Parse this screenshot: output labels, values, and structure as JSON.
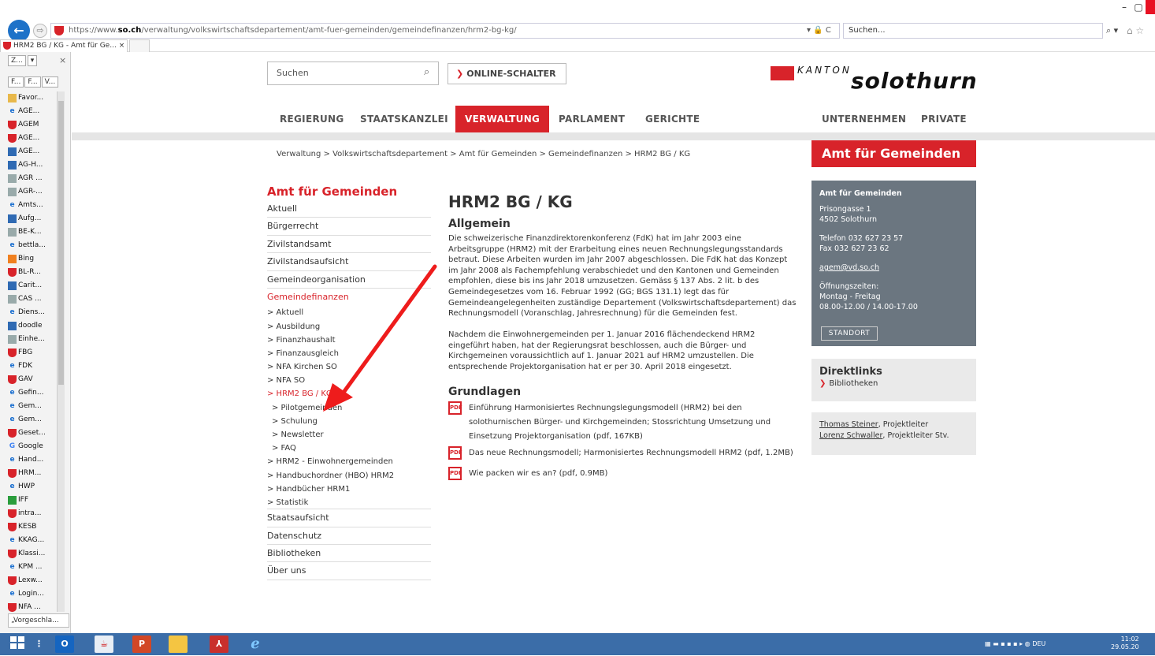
{
  "browser": {
    "url_prefix": "https://www.",
    "url_host": "so.ch",
    "url_path": "/verwaltung/volkswirtschaftsdepartement/amt-fuer-gemeinden/gemeindefinanzen/hrm2-bg-kg/",
    "url_icons": "▾ 🔒 C",
    "search_placeholder": "Suchen...",
    "search_icon": "⌕ ▾",
    "fav_icons": "⌂ ☆",
    "tab_title": "HRM2 BG / KG - Amt für Ge...",
    "tab_close": "×",
    "minimize": "–",
    "maximize": "▢"
  },
  "sidebar": {
    "dropdown_label": "Z...",
    "dropdown_arrow": "▾",
    "close": "×",
    "tabs": [
      "F...",
      "F...",
      "V..."
    ],
    "items": [
      {
        "label": "Favor...",
        "icon": "folder"
      },
      {
        "label": "AGE...",
        "icon": "ie"
      },
      {
        "label": "AGEM",
        "icon": "red"
      },
      {
        "label": "AGE...",
        "icon": "red"
      },
      {
        "label": "AGE...",
        "icon": "blue"
      },
      {
        "label": "AG-H...",
        "icon": "blue"
      },
      {
        "label": "AGR ...",
        "icon": "grey"
      },
      {
        "label": "AGR-...",
        "icon": "grey"
      },
      {
        "label": "Amts...",
        "icon": "ie"
      },
      {
        "label": "Aufg...",
        "icon": "blue"
      },
      {
        "label": "BE-K...",
        "icon": "grey"
      },
      {
        "label": "bettla...",
        "icon": "ie"
      },
      {
        "label": "Bing",
        "icon": "orange"
      },
      {
        "label": "BL-R...",
        "icon": "red"
      },
      {
        "label": "Carit...",
        "icon": "blue"
      },
      {
        "label": "CAS ...",
        "icon": "grey"
      },
      {
        "label": "Diens...",
        "icon": "ie"
      },
      {
        "label": "doodle",
        "icon": "blue"
      },
      {
        "label": "Einhe...",
        "icon": "grey"
      },
      {
        "label": "FBG",
        "icon": "red"
      },
      {
        "label": "FDK",
        "icon": "ie"
      },
      {
        "label": "GAV",
        "icon": "red"
      },
      {
        "label": "Gefin...",
        "icon": "ie"
      },
      {
        "label": "Gem...",
        "icon": "ie"
      },
      {
        "label": "Gem...",
        "icon": "ie"
      },
      {
        "label": "Geset...",
        "icon": "red"
      },
      {
        "label": "Google",
        "icon": "google"
      },
      {
        "label": "Hand...",
        "icon": "ie"
      },
      {
        "label": "HRM...",
        "icon": "red"
      },
      {
        "label": "HWP",
        "icon": "ie"
      },
      {
        "label": "IFF",
        "icon": "green"
      },
      {
        "label": "intra...",
        "icon": "red"
      },
      {
        "label": "KESB",
        "icon": "red"
      },
      {
        "label": "KKAG...",
        "icon": "ie"
      },
      {
        "label": "Klassi...",
        "icon": "red"
      },
      {
        "label": "KPM ...",
        "icon": "ie"
      },
      {
        "label": "Lexw...",
        "icon": "red"
      },
      {
        "label": "Login...",
        "icon": "ie"
      },
      {
        "label": "NFA ...",
        "icon": "red"
      }
    ],
    "bottom_label": "„Vorgeschla..."
  },
  "header": {
    "search_placeholder": "Suchen",
    "search_icon": "⌕",
    "online_chev": "❯",
    "online_label": "ONLINE-SCHALTER",
    "logo_kanton": "KANTON",
    "logo_name": "solothurn"
  },
  "mainnav": {
    "items": [
      {
        "label": "REGIERUNG",
        "active": false
      },
      {
        "label": "STAATSKANZLEI",
        "active": false
      },
      {
        "label": "VERWALTUNG",
        "active": true
      },
      {
        "label": "PARLAMENT",
        "active": false
      },
      {
        "label": "GERICHTE",
        "active": false
      },
      {
        "label": "UNTERNEHMEN",
        "active": false
      },
      {
        "label": "PRIVATE",
        "active": false
      }
    ]
  },
  "breadcrumb": "Verwaltung > Volkswirtschaftsdepartement > Amt für Gemeinden > Gemeindefinanzen > HRM2 BG / KG",
  "right_header": "Amt für Gemeinden",
  "leftnav": {
    "title": "Amt für Gemeinden",
    "top_items": [
      "Aktuell",
      "Bürgerrecht",
      "Zivilstandsamt",
      "Zivilstandsaufsicht",
      "Gemeindeorganisation"
    ],
    "active_section": "Gemeindefinanzen",
    "sub_items": [
      {
        "label": "> Aktuell",
        "level": 1,
        "active": false
      },
      {
        "label": "> Ausbildung",
        "level": 1,
        "active": false
      },
      {
        "label": "> Finanzhaushalt",
        "level": 1,
        "active": false
      },
      {
        "label": "> Finanzausgleich",
        "level": 1,
        "active": false
      },
      {
        "label": "> NFA Kirchen SO",
        "level": 1,
        "active": false
      },
      {
        "label": "> NFA SO",
        "level": 1,
        "active": false
      },
      {
        "label": "> HRM2 BG / KG",
        "level": 1,
        "active": true
      },
      {
        "label": "> Pilotgemeinden",
        "level": 2,
        "active": false
      },
      {
        "label": "> Schulung",
        "level": 2,
        "active": false
      },
      {
        "label": "> Newsletter",
        "level": 2,
        "active": false
      },
      {
        "label": "> FAQ",
        "level": 2,
        "active": false
      },
      {
        "label": "> HRM2 - Einwohnergemeinden",
        "level": 1,
        "active": false
      },
      {
        "label": "> Handbuchordner (HBO) HRM2",
        "level": 1,
        "active": false
      },
      {
        "label": "> Handbücher HRM1",
        "level": 1,
        "active": false
      },
      {
        "label": "> Statistik",
        "level": 1,
        "active": false
      }
    ],
    "bottom_items": [
      "Staatsaufsicht",
      "Datenschutz",
      "Bibliotheken",
      "Über uns"
    ]
  },
  "content": {
    "title": "HRM2 BG / KG",
    "h_allgemein": "Allgemein",
    "p1": "Die schweizerische Finanzdirektorenkonferenz (FdK) hat im Jahr 2003 eine Arbeitsgruppe (HRM2) mit der Erarbeitung eines neuen Rechnungslegungsstandards betraut. Diese Arbeiten wurden im Jahr 2007 abgeschlossen. Die FdK hat das Konzept im Jahr 2008 als Fachempfehlung verabschiedet und den Kantonen und Gemeinden empfohlen, diese bis ins Jahr 2018 umzusetzen. Gemäss § 137 Abs. 2 lit. b des Gemeindegesetzes vom 16. Februar 1992 (GG; BGS 131.1) legt das für Gemeindeangelegenheiten zuständige Departement (Volkswirtschaftsdepartement) das Rechnungsmodell (Voranschlag, Jahresrechnung) für die Gemeinden fest.",
    "p2": "Nachdem die Einwohnergemeinden per 1. Januar 2016 flächendeckend HRM2 eingeführt haben, hat der Regierungsrat beschlossen, auch die Bürger- und Kirchgemeinen voraussichtlich auf  1. Januar 2021 auf HRM2 umzustellen. Die entsprechende Projektorganisation hat er per 30. April 2018 eingesetzt.",
    "h_grundlagen": "Grundlagen",
    "pdf_label": "PDF",
    "docs": [
      "Einführung Harmonisiertes Rechnungslegungsmodell (HRM2) bei den solothurnischen Bürger- und Kirchgemeinden; Stossrichtung Umsetzung und Einsetzung Projektorganisation (pdf, 167KB)",
      "Das neue Rechnungsmodell; Harmonisiertes Rechnungsmodell HRM2 (pdf, 1.2MB)",
      "Wie packen wir es an? (pdf, 0.9MB)"
    ]
  },
  "contact": {
    "title": "Amt für Gemeinden",
    "street": "Prisongasse 1",
    "city": "4502 Solothurn",
    "phone": "Telefon 032 627 23 57",
    "fax": "Fax 032 627 23 62",
    "email": "agem@vd.so.ch",
    "hours_label": "Öffnungszeiten:",
    "hours_days": "Montag - Freitag",
    "hours_times": "08.00-12.00 / 14.00-17.00",
    "button": "STANDORT"
  },
  "direktlinks": {
    "title": "Direktlinks",
    "chev": "❯",
    "item": "Bibliotheken"
  },
  "people": {
    "p1_name": "Thomas Steiner",
    "p1_role": ", Projektleiter",
    "p2_name": "Lorenz Schwaller",
    "p2_role": ", Projektleiter Stv."
  },
  "taskbar": {
    "outlook": "O",
    "powerpoint": "P",
    "tray_lang": "DEU",
    "time": "11:02",
    "date": "29.05.20"
  },
  "colors": {
    "brand_red": "#d8232a",
    "contact_grey": "#6b7680",
    "taskbar": "#3b6da8"
  }
}
